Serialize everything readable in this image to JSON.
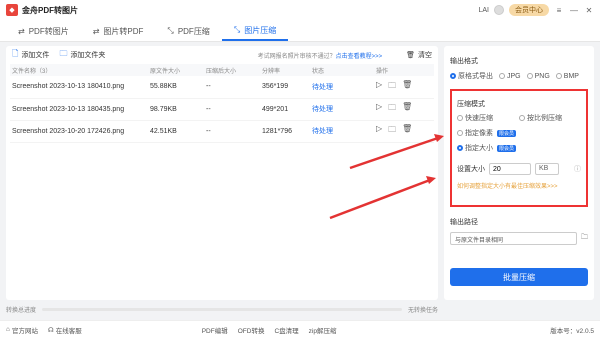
{
  "app": {
    "title": "金舟PDF转图片",
    "user": "LAI",
    "vip_label": "会员中心"
  },
  "tabs": [
    {
      "label": "PDF转图片",
      "active": false
    },
    {
      "label": "图片转PDF",
      "active": false
    },
    {
      "label": "PDF压缩",
      "active": false
    },
    {
      "label": "图片压缩",
      "active": true
    }
  ],
  "toolbar": {
    "add_file": "添加文件",
    "add_folder": "添加文件夹",
    "hint_text": "考试网报名照片审核不通过？",
    "hint_link": "点击查看教程>>>",
    "clear": "清空"
  },
  "table": {
    "headers": [
      "文件名称（3）",
      "原文件大小",
      "压缩后大小",
      "分辨率",
      "状态",
      "操作"
    ],
    "rows": [
      {
        "name": "Screenshot 2023-10-13 180410.png",
        "size": "55.88KB",
        "after": "--",
        "res": "356*199",
        "status": "待处理"
      },
      {
        "name": "Screenshot 2023-10-13 180435.png",
        "size": "98.79KB",
        "after": "--",
        "res": "499*201",
        "status": "待处理"
      },
      {
        "name": "Screenshot 2023-10-20 172426.png",
        "size": "42.51KB",
        "after": "--",
        "res": "1281*796",
        "status": "待处理"
      }
    ]
  },
  "output_format": {
    "label": "输出格式",
    "options": [
      {
        "label": "原格式导出",
        "selected": true
      },
      {
        "label": "JPG",
        "selected": false
      },
      {
        "label": "PNG",
        "selected": false
      },
      {
        "label": "BMP",
        "selected": false
      }
    ]
  },
  "compress": {
    "label": "压缩模式",
    "modes": [
      {
        "label": "快速压缩",
        "selected": false,
        "badge": ""
      },
      {
        "label": "按比例压缩",
        "selected": false,
        "badge": ""
      },
      {
        "label": "指定像素",
        "selected": false,
        "badge": "限会员"
      },
      {
        "label": "指定大小",
        "selected": true,
        "badge": "限会员"
      }
    ],
    "size_label": "设置大小",
    "size_value": "20",
    "size_unit": "KB",
    "tip": "如何调整指定大小有最佳压缩效果>>>"
  },
  "output_path": {
    "label": "输出路径",
    "value": "与原文件目录相同"
  },
  "batch_button": "批量压缩",
  "progress": {
    "label": "转换总进度",
    "value": 0,
    "task_label": "无转换任务"
  },
  "footer": {
    "website": "官方网站",
    "service": "在线客服",
    "links": [
      "PDF编辑",
      "OFD转换",
      "C盘清理",
      "zip解压缩"
    ],
    "version": "版本号：v2.0.5"
  },
  "accent_color": "#1f6feb",
  "highlight_color": "#e33333"
}
